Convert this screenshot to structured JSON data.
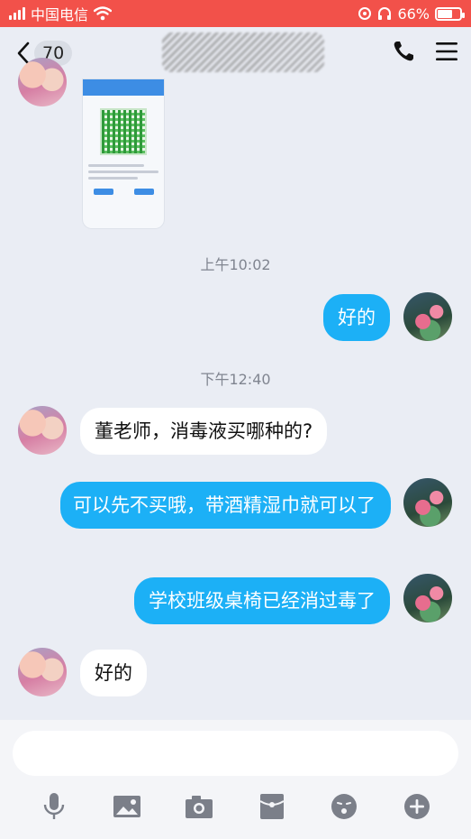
{
  "status_bar": {
    "carrier": "中国电信",
    "battery_percent": "66%",
    "battery_level": 0.66
  },
  "header": {
    "back_count": "70"
  },
  "messages": {
    "time_1": "上午10:02",
    "reply_1": "好的",
    "time_2": "下午12:40",
    "question": "董老师，消毒液买哪种的?",
    "answer_1": "可以先不买哦，带酒精湿巾就可以了",
    "answer_2": "学校班级桌椅已经消过毒了",
    "reply_2": "好的"
  },
  "input": {
    "placeholder": ""
  },
  "icons": {
    "signal": "signal-icon",
    "wifi": "wifi-icon",
    "alarm": "alarm-icon",
    "headphones": "headphones-icon",
    "battery": "battery-icon",
    "back": "chevron-left-icon",
    "call": "phone-icon",
    "menu": "menu-icon",
    "voice": "microphone-icon",
    "image": "image-icon",
    "camera": "camera-icon",
    "red_packet": "red-packet-icon",
    "emoji": "emoji-icon",
    "more": "plus-circle-icon"
  },
  "colors": {
    "status_bar": "#f2514a",
    "outgoing_bubble": "#1cb0f6",
    "background": "#eaedf4"
  }
}
